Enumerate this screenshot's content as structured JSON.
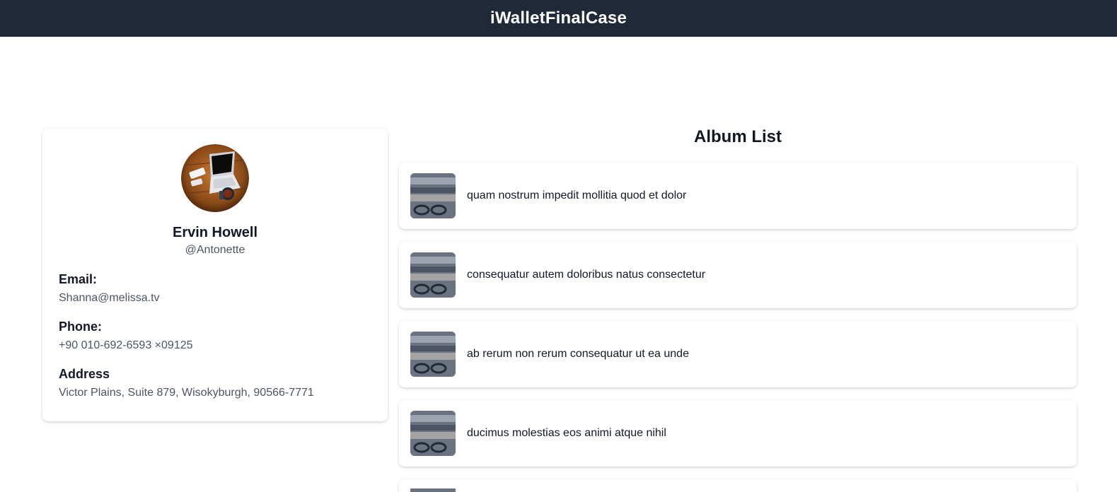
{
  "header": {
    "brand": "iWalletFinalCase"
  },
  "profile": {
    "avatar_icon": "laptop-photo",
    "name": "Ervin Howell",
    "username": "@Antonette",
    "email_label": "Email:",
    "email": "Shanna@melissa.tv",
    "phone_label": "Phone:",
    "phone": "+90 010-692-6593 ×09125",
    "address_label": "Address",
    "address": "Victor Plains, Suite 879, Wisokyburgh, 90566-7771"
  },
  "albums": {
    "title": "Album List",
    "items": [
      {
        "title": "quam nostrum impedit mollitia quod et dolor"
      },
      {
        "title": "consequatur autem doloribus natus consectetur"
      },
      {
        "title": "ab rerum non rerum consequatur ut ea unde"
      },
      {
        "title": "ducimus molestias eos animi atque nihil"
      },
      {
        "title": ""
      }
    ]
  },
  "colors": {
    "header_bg": "#1f2937",
    "text_primary": "#111827",
    "text_secondary": "#4b5563"
  }
}
